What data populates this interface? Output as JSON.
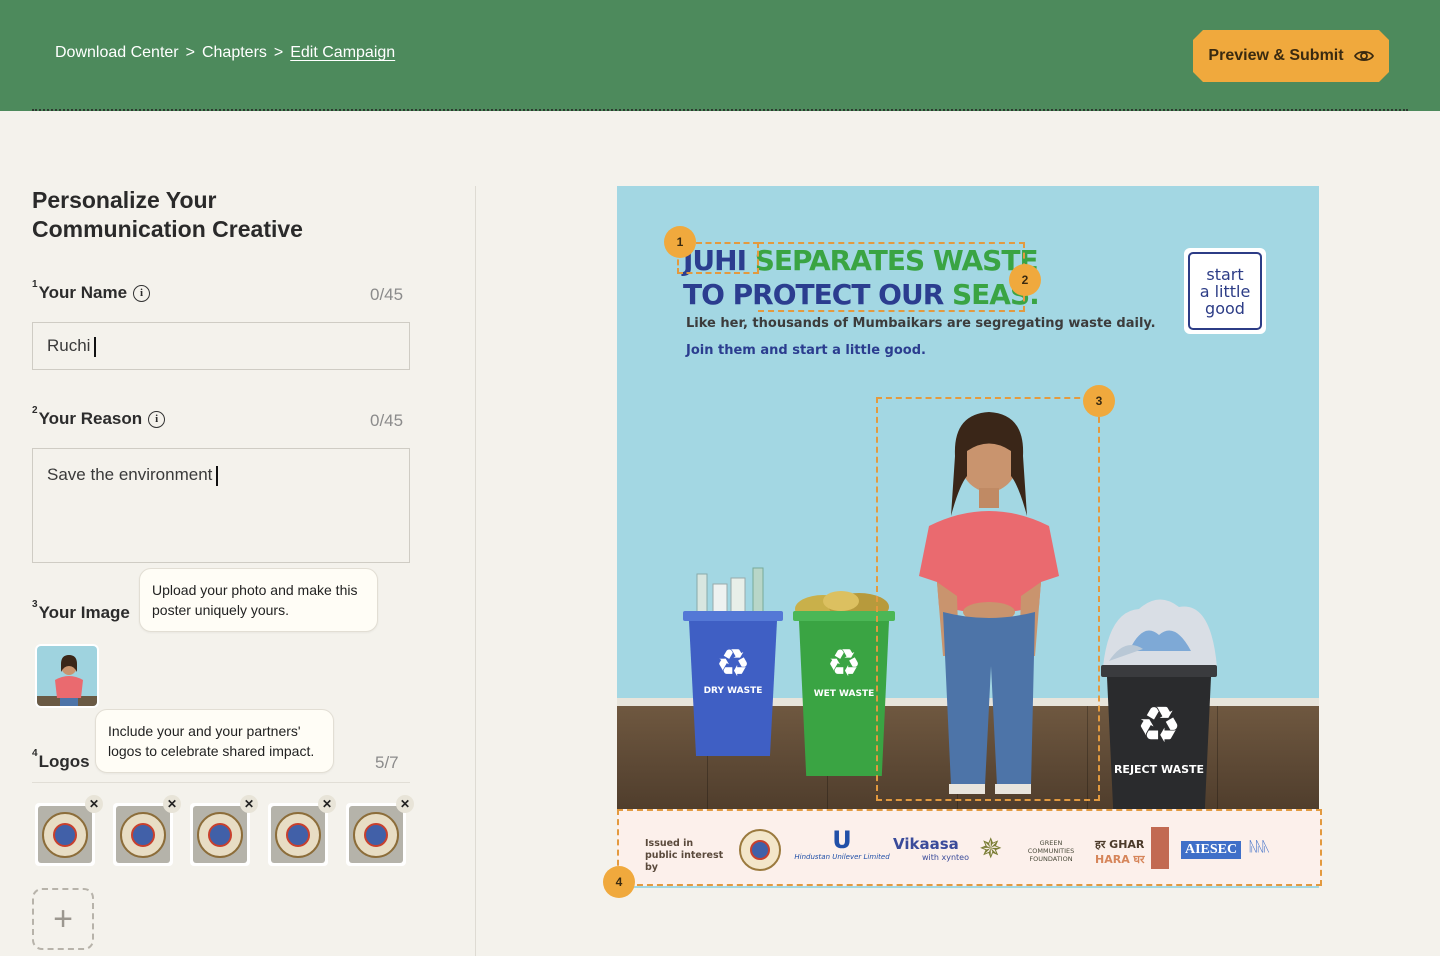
{
  "breadcrumb": {
    "items": [
      "Download Center",
      "Chapters",
      "Edit Campaign"
    ],
    "separator": ">"
  },
  "header": {
    "preview_label": "Preview & Submit",
    "preview_icon": "eye-icon"
  },
  "panel": {
    "title": "Personalize Your Communication Creative",
    "name_field": {
      "number": "1",
      "label": "Your Name",
      "counter": "0/45",
      "value": "Ruchi"
    },
    "reason_field": {
      "number": "2",
      "label": "Your Reason",
      "counter": "0/45",
      "value": "Save the environment"
    },
    "image_field": {
      "number": "3",
      "label": "Your Image",
      "tooltip": "Upload your photo and make this poster uniquely yours."
    },
    "logos_field": {
      "number": "4",
      "label": "Logos",
      "counter": "5/7",
      "tooltip": "Include your and your partners' logos to celebrate shared impact.",
      "logo_count": 5,
      "remove_symbol": "✕",
      "add_symbol": "+"
    }
  },
  "poster": {
    "headline_name": "JUHI",
    "headline_line1_rest": "SEPARATES WASTE",
    "headline_to": "TO",
    "headline_protect": "PROTECT OUR",
    "headline_seas": "SEAS.",
    "subline": "Like her, thousands of Mumbaikars are segregating waste daily.",
    "cta": "Join them and start a little good.",
    "badge_lines": [
      "start",
      "a little",
      "good"
    ],
    "bins": [
      {
        "label": "DRY WASTE",
        "color": "#3f5fc4"
      },
      {
        "label": "WET WASTE",
        "color": "#3aa443"
      },
      {
        "label": "REJECT WASTE",
        "color": "#2a2b2d"
      }
    ],
    "markers": [
      "1",
      "2",
      "3",
      "4"
    ],
    "footer": {
      "issued_text": "Issued in public interest by",
      "partners": [
        "Hindustan Unilever Limited",
        "Vikaasa",
        "with xynteo",
        "GREEN COMMUNITIES FOUNDATION",
        "हर GHAR",
        "HARA घर",
        "AIESEC"
      ]
    }
  },
  "colors": {
    "header_green": "#4d8a5c",
    "accent_orange": "#f0a93d",
    "poster_sky": "#a3d7e3"
  }
}
